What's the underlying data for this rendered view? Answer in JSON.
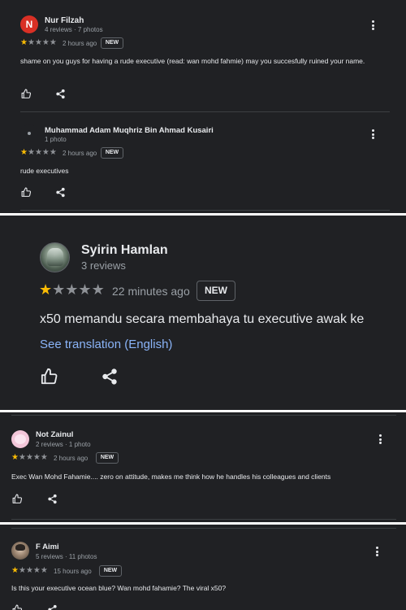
{
  "reviews": [
    {
      "avatar_letter": "N",
      "avatar_color": "#d93025",
      "name": "Nur Filzah",
      "meta": "4 reviews · 7 photos",
      "time": "2 hours ago",
      "badge": "NEW",
      "rating": 1,
      "text": "shame on you guys for having a rude executive (read: wan mohd fahmie) may you succesfully ruined your name."
    },
    {
      "avatar_letter": "",
      "name": "Muhammad Adam Muqhriz Bin Ahmad Kusairi",
      "meta": "1 photo",
      "time": "2 hours ago",
      "badge": "NEW",
      "rating": 1,
      "text": "rude executives"
    },
    {
      "name": "Syirin Hamlan",
      "meta": "3 reviews",
      "time": "22 minutes ago",
      "badge": "NEW",
      "rating": 1,
      "text": "x50 memandu secara membahaya tu executive awak ke",
      "translate": "See translation (English)"
    },
    {
      "name": "Not Zainul",
      "meta": "2 reviews · 1 photo",
      "time": "2 hours ago",
      "badge": "NEW",
      "rating": 1,
      "text": "Exec Wan Mohd Fahamie.... zero on attitude, makes me think how he handles his colleagues and clients"
    },
    {
      "name": "F Aimi",
      "meta": "5 reviews · 11 photos",
      "time": "15 hours ago",
      "badge": "NEW",
      "rating": 1,
      "text": "Is this your executive ocean blue? Wan mohd fahamie? The viral x50?"
    }
  ],
  "icons": {
    "like": "thumbs-up-icon",
    "share": "share-icon",
    "more": "more-vert-icon"
  },
  "colors": {
    "background": "#202124",
    "star_on": "#fbbc04",
    "star_off": "#8e9196",
    "link": "#8ab4f8"
  }
}
